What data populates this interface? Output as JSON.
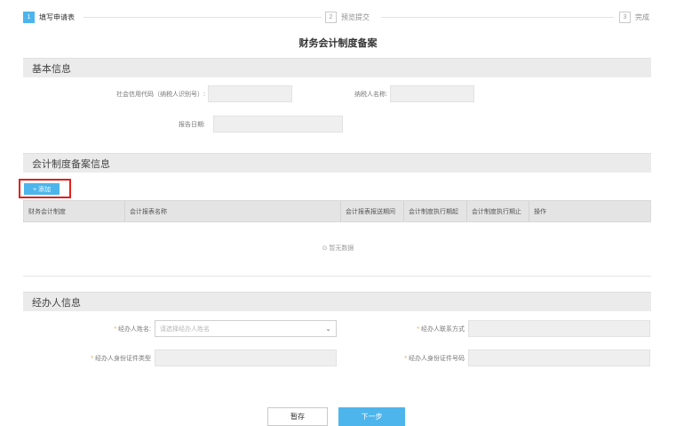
{
  "steps": [
    {
      "num": "1",
      "label": "填写申请表",
      "active": true
    },
    {
      "num": "2",
      "label": "预览提交",
      "active": false
    },
    {
      "num": "3",
      "label": "完成",
      "active": false
    }
  ],
  "page_title": "财务会计制度备案",
  "basic_info": {
    "header": "基本信息",
    "credit_code_label": "社会信用代码（纳税人识别号）:",
    "taxpayer_name_label": "纳税人名称:",
    "report_date_label": "报告日期:"
  },
  "filing_info": {
    "header": "会计制度备案信息",
    "add_label": "+ 添加",
    "columns": [
      "财务会计制度",
      "会计报表名称",
      "会计报表报送期间",
      "会计制度执行期起",
      "会计制度执行期止",
      "操作"
    ],
    "empty_text": "暂无数据"
  },
  "handler_info": {
    "header": "经办人信息",
    "name_label": "经办人姓名:",
    "name_placeholder": "请选择经办人姓名",
    "contact_label": "经办人联系方式",
    "id_type_label": "经办人身份证件类型",
    "id_number_label": "经办人身份证件号码"
  },
  "buttons": {
    "save": "暂存",
    "next": "下一步"
  },
  "colors": {
    "accent": "#4db5ec",
    "highlight_border": "#e0211e",
    "required": "#e7a23a"
  }
}
